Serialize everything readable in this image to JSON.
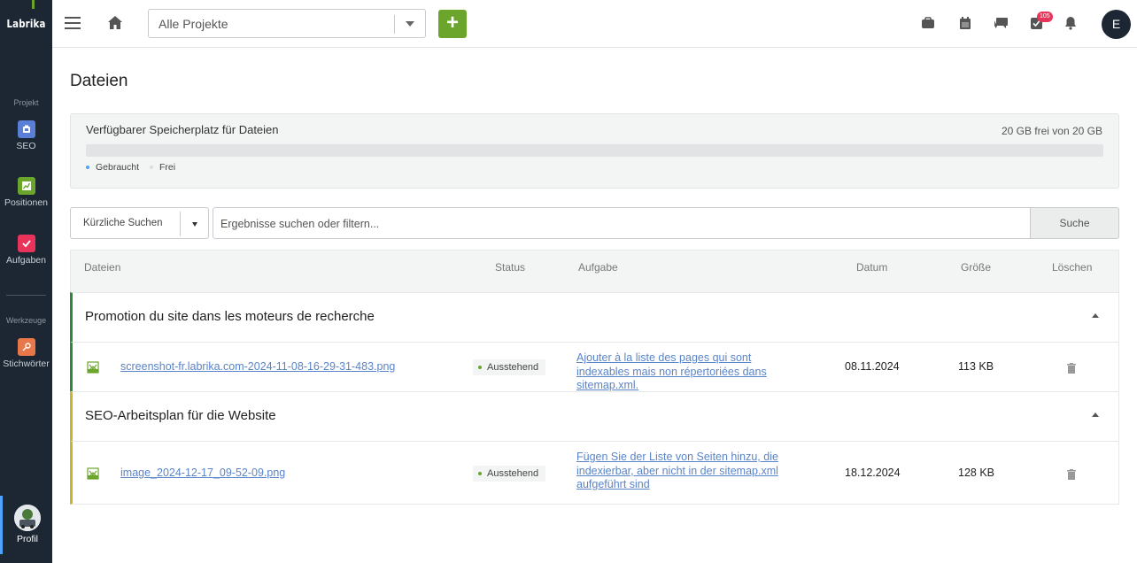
{
  "app": {
    "logo_text": "Labrika",
    "user_initial": "E",
    "notification_badge": "105"
  },
  "sidebar": {
    "section_project": "Projekt",
    "section_tools": "Werkzeuge",
    "items": [
      {
        "label": "SEO",
        "icon": "seo-icon",
        "color": "#5b7fd6"
      },
      {
        "label": "Positionen",
        "icon": "chart-icon",
        "color": "#6ca52c"
      },
      {
        "label": "Aufgaben",
        "icon": "check-icon",
        "color": "#e8345a"
      },
      {
        "label": "Stichwörter",
        "icon": "key-icon",
        "color": "#e8774a"
      }
    ],
    "profile_label": "Profil"
  },
  "topbar": {
    "project_select": "Alle Projekte",
    "add_label": "+"
  },
  "page": {
    "title": "Dateien"
  },
  "storage": {
    "title": "Verfügbarer Speicherplatz für Dateien",
    "free_text": "20 GB frei von 20 GB",
    "used_fraction": 0.0,
    "legend_used": "Gebraucht",
    "legend_free": "Frei",
    "used_color": "#4da3ff",
    "free_color": "#e2e3e4"
  },
  "search": {
    "recent_label": "Kürzliche Suchen",
    "placeholder": "Ergebnisse suchen oder filtern...",
    "button": "Suche"
  },
  "table": {
    "headers": {
      "files": "Dateien",
      "status": "Status",
      "task": "Aufgabe",
      "date": "Datum",
      "size": "Größe",
      "delete": "Löschen"
    },
    "groups": [
      {
        "title": "Promotion du site dans les moteurs de recherche",
        "rows": [
          {
            "file": "screenshot-fr.labrika.com-2024-11-08-16-29-31-483.png",
            "status": "Ausstehend",
            "task": "Ajouter à la liste des pages qui sont indexables mais non répertoriées dans sitemap.xml.",
            "date": "08.11.2024",
            "size": "113 KB"
          }
        ]
      },
      {
        "title": "SEO-Arbeitsplan für die Website",
        "rows": [
          {
            "file": "image_2024-12-17_09-52-09.png",
            "status": "Ausstehend",
            "task": "Fügen Sie der Liste von Seiten hinzu, die indexierbar, aber nicht in der sitemap.xml aufgeführt sind",
            "date": "18.12.2024",
            "size": "128 KB"
          }
        ]
      }
    ]
  }
}
